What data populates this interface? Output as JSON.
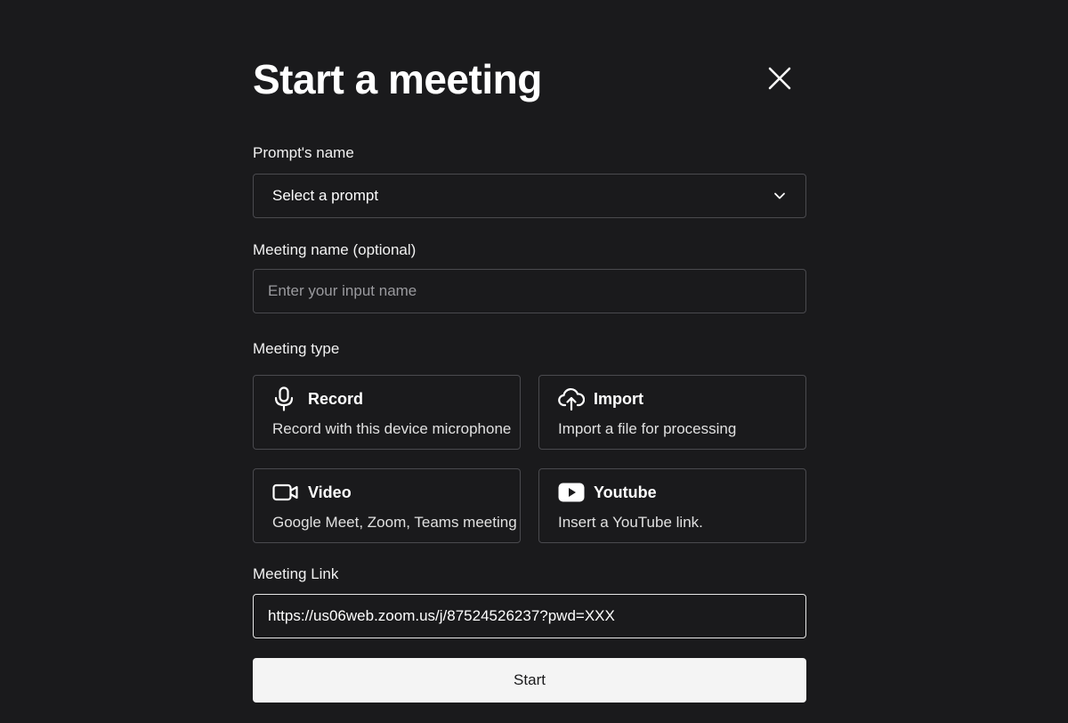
{
  "modal": {
    "title": "Start a meeting"
  },
  "prompt_field": {
    "label": "Prompt's name",
    "selected": "Select a prompt"
  },
  "meeting_name_field": {
    "label": "Meeting name (optional)",
    "placeholder": "Enter your input name",
    "value": ""
  },
  "meeting_type": {
    "label": "Meeting type",
    "options": [
      {
        "title": "Record",
        "description": "Record with this device microphone",
        "icon": "microphone-icon"
      },
      {
        "title": "Import",
        "description": "Import a file for processing",
        "icon": "cloud-upload-icon"
      },
      {
        "title": "Video",
        "description": "Google Meet, Zoom, Teams meeting",
        "icon": "video-camera-icon"
      },
      {
        "title": "Youtube",
        "description": "Insert a YouTube link.",
        "icon": "youtube-icon"
      }
    ]
  },
  "meeting_link_field": {
    "label": "Meeting Link",
    "value": "https://us06web.zoom.us/j/87524526237?pwd=XXX"
  },
  "actions": {
    "start_label": "Start"
  },
  "colors": {
    "background": "#1a1a1c",
    "border": "#4a4a4e",
    "button_bg": "#f4f4f4"
  }
}
